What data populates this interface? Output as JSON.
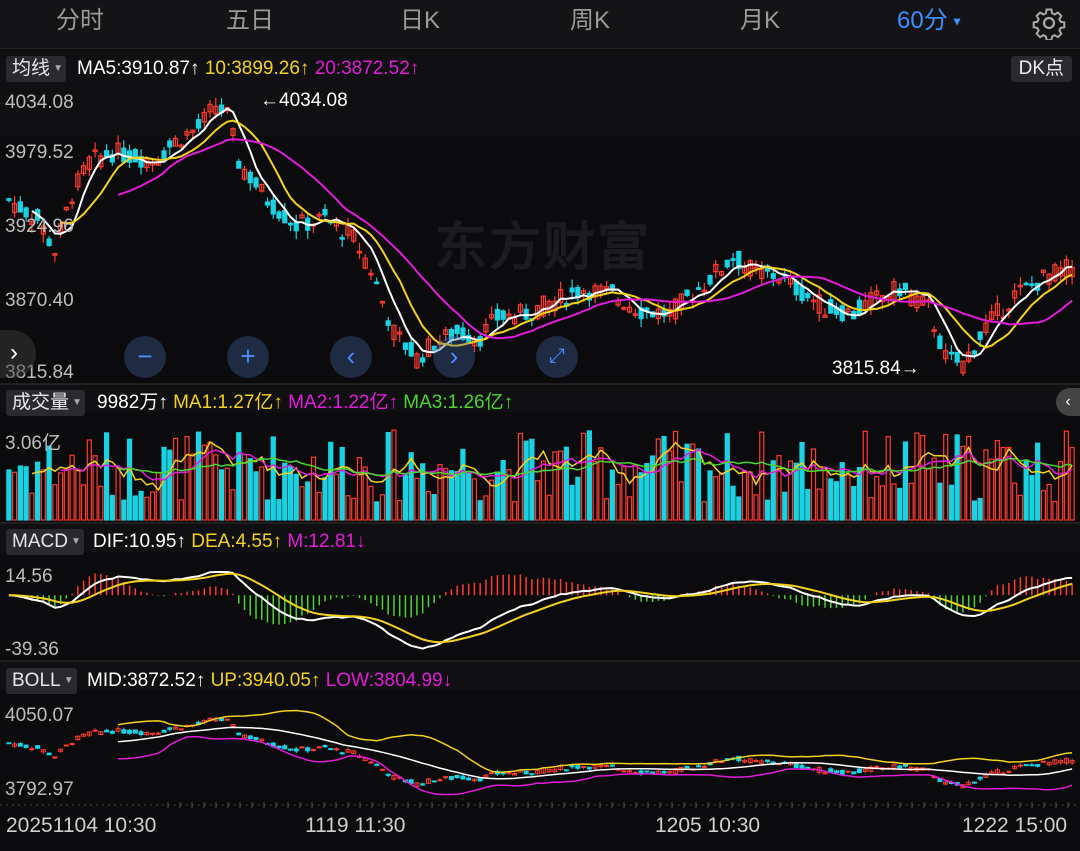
{
  "tabs": [
    "分时",
    "五日",
    "日K",
    "周K",
    "月K",
    "60分"
  ],
  "active_tab": "60分",
  "toolbar": {
    "ma_selector": "均线",
    "ma5": "MA5:3910.87↑",
    "ma10": "10:3899.26↑",
    "ma20": "20:3872.52↑",
    "dk_button": "DK点"
  },
  "watermark": "东方财富",
  "kline": {
    "y_labels": [
      "4034.08",
      "3979.52",
      "3924.96",
      "3870.40",
      "3815.84"
    ],
    "high_annotation": "←4034.08",
    "low_annotation": "3815.84→"
  },
  "volume": {
    "selector": "成交量",
    "current": "9982万↑",
    "ma1": "MA1:1.27亿↑",
    "ma2": "MA2:1.22亿↑",
    "ma3": "MA3:1.26亿↑",
    "y_label": "3.06亿"
  },
  "macd": {
    "selector": "MACD",
    "dif": "DIF:10.95↑",
    "dea": "DEA:4.55↑",
    "m": "M:12.81↓",
    "y_top": "14.56",
    "y_bottom": "-39.36"
  },
  "boll": {
    "selector": "BOLL",
    "mid": "MID:3872.52↑",
    "up": "UP:3940.05↑",
    "low": "LOW:3804.99↓",
    "y_top": "4050.07",
    "y_bottom": "3792.97"
  },
  "x_labels": [
    "20251104 10:30",
    "1119 11:30",
    "1205 10:30",
    "1222 15:00"
  ],
  "colors": {
    "up": "#ff3b30",
    "down": "#19d3e3",
    "ma5": "#ffffff",
    "ma10": "#f2d21c",
    "ma20": "#e21bd9",
    "accent": "#3b8fff"
  },
  "chart_data": {
    "type": "candlestick",
    "title": "",
    "n_bars": 140,
    "y_range": [
      3815.84,
      4034.08
    ],
    "max_high": 4034.08,
    "min_low": 3815.84,
    "close_anchors": [
      [
        0,
        3955
      ],
      [
        5,
        3940
      ],
      [
        8,
        3915
      ],
      [
        11,
        3960
      ],
      [
        14,
        3985
      ],
      [
        18,
        3993
      ],
      [
        25,
        3987
      ],
      [
        30,
        4005
      ],
      [
        33,
        4012
      ],
      [
        36,
        4030
      ],
      [
        38,
        4022
      ],
      [
        40,
        3985
      ],
      [
        45,
        3955
      ],
      [
        50,
        3935
      ],
      [
        55,
        3940
      ],
      [
        60,
        3925
      ],
      [
        63,
        3900
      ],
      [
        67,
        3850
      ],
      [
        71,
        3830
      ],
      [
        74,
        3842
      ],
      [
        78,
        3850
      ],
      [
        82,
        3847
      ],
      [
        85,
        3862
      ],
      [
        90,
        3865
      ],
      [
        95,
        3875
      ],
      [
        100,
        3885
      ],
      [
        105,
        3880
      ],
      [
        110,
        3868
      ],
      [
        115,
        3865
      ],
      [
        120,
        3885
      ],
      [
        126,
        3910
      ],
      [
        130,
        3897
      ],
      [
        134,
        3895
      ],
      [
        138,
        3882
      ],
      [
        142,
        3870
      ],
      [
        147,
        3865
      ],
      [
        150,
        3875
      ],
      [
        155,
        3885
      ],
      [
        160,
        3870
      ],
      [
        163,
        3830
      ],
      [
        166,
        3825
      ],
      [
        170,
        3855
      ],
      [
        175,
        3880
      ],
      [
        180,
        3893
      ],
      [
        186,
        3904
      ]
    ],
    "volume_range": [
      0,
      3.06
    ],
    "macd_range": [
      -39.36,
      14.56
    ],
    "boll_range": [
      3792.97,
      4050.07
    ]
  }
}
